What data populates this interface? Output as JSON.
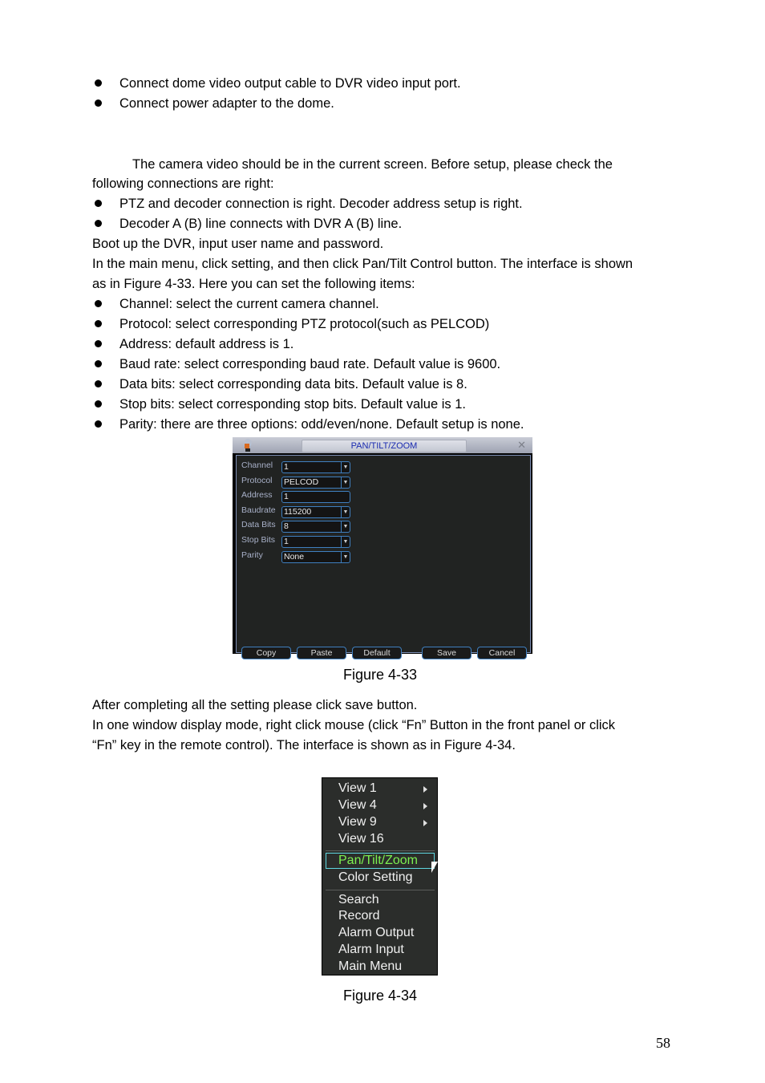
{
  "paragraphs": {
    "bullets_top": [
      "Connect dome video output cable to DVR video input port.",
      "Connect power adapter to the dome."
    ],
    "intro_line1": "The camera video should be in the current screen. Before setup, please check the",
    "intro_line2": "following connections are right:",
    "bullets_check": [
      "PTZ and decoder connection is right. Decoder address setup is right.",
      "Decoder A (B) line connects with DVR A (B) line."
    ],
    "boot_line": "Boot up the DVR, input user name and password.",
    "menu_line1": "In the main menu, click setting, and then click Pan/Tilt Control button. The interface is shown",
    "menu_line2": "as in Figure 4-33. Here you can set the following items:",
    "bullets_items": [
      "Channel: select the current camera channel.",
      "Protocol: select corresponding PTZ protocol(such as PELCOD)",
      "Address: default address is 1.",
      "Baud rate: select corresponding baud rate. Default value is 9600.",
      "Data bits: select corresponding data bits. Default value is 8.",
      "Stop bits: select corresponding stop bits. Default value is 1.",
      "Parity: there are three options: odd/even/none. Default setup is none."
    ],
    "after_line": "After completing all the setting please click save button.",
    "window_line1": "In one window display mode, right click mouse (click “Fn” Button in the front panel or click",
    "window_line2": "“Fn” key in the remote control). The interface is shown as in Figure 4-34."
  },
  "figure_33": {
    "caption": "Figure 4-33",
    "dialog": {
      "title": "PAN/TILT/ZOOM",
      "close_icon": "✕",
      "fields": [
        {
          "label": "Channel",
          "value": "1",
          "dropdown": true
        },
        {
          "label": "Protocol",
          "value": "PELCOD",
          "dropdown": true
        },
        {
          "label": "Address",
          "value": "1",
          "dropdown": false
        },
        {
          "label": "Baudrate",
          "value": "115200",
          "dropdown": true
        },
        {
          "label": "Data Bits",
          "value": "8",
          "dropdown": true
        },
        {
          "label": "Stop Bits",
          "value": "1",
          "dropdown": true
        },
        {
          "label": "Parity",
          "value": "None",
          "dropdown": true
        }
      ],
      "dropdown_arrow": "▼",
      "buttons": {
        "copy": "Copy",
        "paste": "Paste",
        "default": "Default",
        "save": "Save",
        "cancel": "Cancel"
      }
    }
  },
  "figure_34": {
    "caption": "Figure 4-34",
    "menu": {
      "items": [
        {
          "label": "View 1",
          "submenu": true
        },
        {
          "label": "View 4",
          "submenu": true
        },
        {
          "label": "View 9",
          "submenu": true
        },
        {
          "label": "View 16",
          "submenu": false
        },
        {
          "label": "Pan/Tilt/Zoom",
          "submenu": false,
          "highlighted": true
        },
        {
          "label": "Color Setting",
          "submenu": false
        },
        {
          "label": "Search",
          "submenu": false
        },
        {
          "label": "Record",
          "submenu": false
        },
        {
          "label": "Alarm Output",
          "submenu": false
        },
        {
          "label": "Alarm Input",
          "submenu": false
        },
        {
          "label": "Main Menu",
          "submenu": false
        }
      ]
    }
  },
  "page_number": "58"
}
